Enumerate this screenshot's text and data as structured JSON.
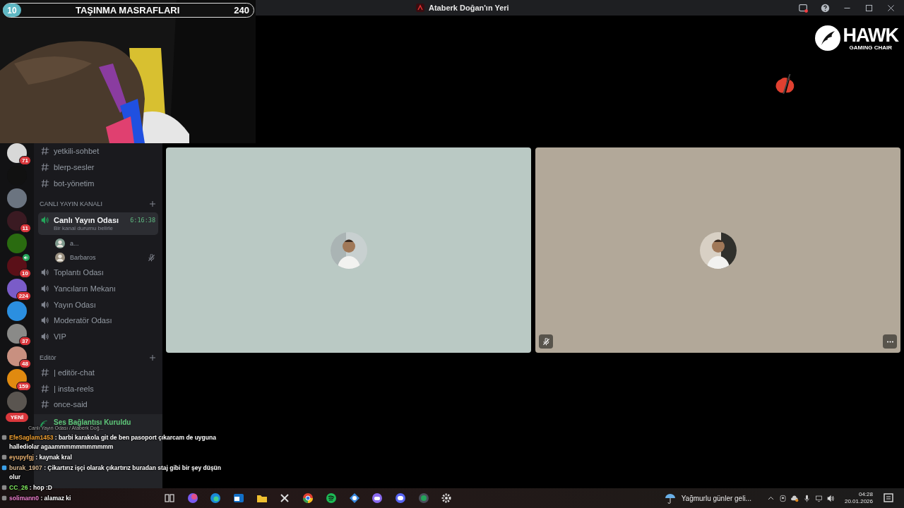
{
  "overlay": {
    "count": "10",
    "title": "TAŞINMA MASRAFLARI",
    "amount": "240"
  },
  "window": {
    "title": "Ataberk Doğan'ın Yeri"
  },
  "brand": {
    "name": "HAWK",
    "tagline": "GAMING CHAIR"
  },
  "servers": [
    {
      "color": "#d8d8d8",
      "badge": "71"
    },
    {
      "color": "#111111"
    },
    {
      "color": "#6b7480"
    },
    {
      "color": "#3a1a22",
      "badge": "11"
    },
    {
      "color": "#2a6b10"
    },
    {
      "color": "#5a1018",
      "badge": "10",
      "speaking": true
    },
    {
      "color": "#7a5cc8",
      "badge": "224"
    },
    {
      "color": "#2b8fe0"
    },
    {
      "color": "#8a8a88",
      "badge": "37"
    },
    {
      "color": "#c89080",
      "badge": "48"
    },
    {
      "color": "#e08a10",
      "badge": "159"
    },
    {
      "color": "#5a5550"
    }
  ],
  "new_badge": "YENİ",
  "channels": [
    {
      "kind": "text",
      "label": "yetkili-sohbet"
    },
    {
      "kind": "text",
      "label": "blerp-sesler"
    },
    {
      "kind": "text",
      "label": "bot-yönetim"
    },
    {
      "kind": "category",
      "label": "CANLI YAYIN KANALI"
    },
    {
      "kind": "voice",
      "label": "Canlı Yayın Odası",
      "selected": true,
      "timer": "6:16:38",
      "status": "Bir kanal durumu belirle",
      "members": [
        {
          "name": "a...",
          "muted": false
        },
        {
          "name": "Barbaros",
          "muted": true
        }
      ]
    },
    {
      "kind": "voice",
      "label": "Toplantı Odası",
      "selected": false
    },
    {
      "kind": "voice",
      "label": "Yancıların Mekanı",
      "selected": false
    },
    {
      "kind": "voice",
      "label": "Yayın Odası",
      "selected": false
    },
    {
      "kind": "voice",
      "label": "Moderatör Odası",
      "selected": false
    },
    {
      "kind": "voice",
      "label": "VIP",
      "selected": false
    },
    {
      "kind": "category",
      "label": "Editör"
    },
    {
      "kind": "text",
      "label": "| editör-chat"
    },
    {
      "kind": "text",
      "label": "| insta-reels"
    },
    {
      "kind": "text",
      "label": "once-said"
    }
  ],
  "voice_panel": {
    "status": "Ses Bağlantısı Kuruldu",
    "location": "Canlı Yayın Odası / Ataberk Doğ..."
  },
  "tiles": [
    {
      "color": "#bac9c4",
      "muted": false,
      "menu": false
    },
    {
      "color": "#b2a899",
      "muted": true,
      "menu": true
    }
  ],
  "chat": [
    {
      "user": "EfeSaglam1453",
      "color": "#f0a030",
      "text": ": barbi karakola git de ben pasoport çıkarcam de uyguna hallediolar agaammmmmmmmmmm"
    },
    {
      "user": "eyupyfgj",
      "color": "#e8b070",
      "text": ": kaynak kral"
    },
    {
      "user": "burak_1907",
      "color": "#d8b890",
      "text": ": Çikartırız işçi olarak çıkartırız buradan staj gibi bir şey düşün olur"
    },
    {
      "user": "CC_26",
      "color": "#80f060",
      "text": ": hop :D"
    },
    {
      "user": "solimann0",
      "color": "#f080d0",
      "text": ": alamaz ki"
    }
  ],
  "taskbar": {
    "weather": "Yağmurlu günler geli...",
    "time": "04:28",
    "date": "20.01.2026"
  }
}
